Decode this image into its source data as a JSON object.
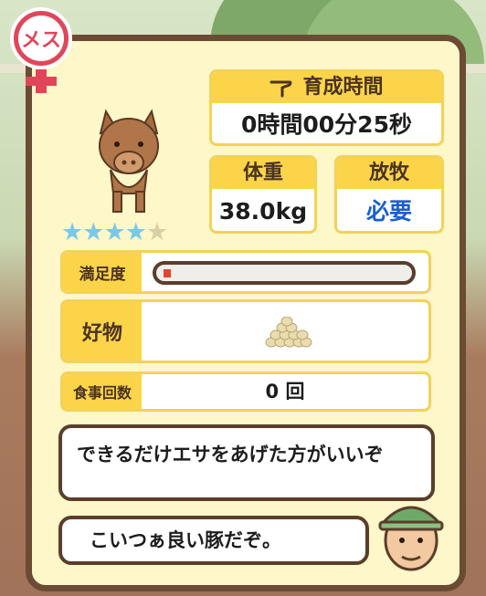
{
  "gender": {
    "label": "メス"
  },
  "growth_time": {
    "label": "育成時間",
    "value": "0時間00分25秒"
  },
  "weight": {
    "label": "体重",
    "value": "38.0kg"
  },
  "grazing": {
    "label": "放牧",
    "value": "必要"
  },
  "rating": {
    "stars_filled": 4,
    "stars_total": 5
  },
  "satisfaction": {
    "label": "満足度",
    "level": 0.03
  },
  "favorite": {
    "label": "好物",
    "item_icon": "feed-pellets-icon"
  },
  "meals": {
    "label": "食事回数",
    "value": "0 回"
  },
  "speech": {
    "advice": "できるだけエサをあげた方がいいぞ",
    "comment": "こいつぁ良い豚だぞ。"
  },
  "colors": {
    "panel_bg": "#fdf7c9",
    "panel_border": "#6b4b33",
    "header_yellow": "#fbd44a",
    "grazing_blue": "#1a5fd0",
    "star_blue": "#7bc8e6",
    "gender_red": "#e0465a"
  }
}
